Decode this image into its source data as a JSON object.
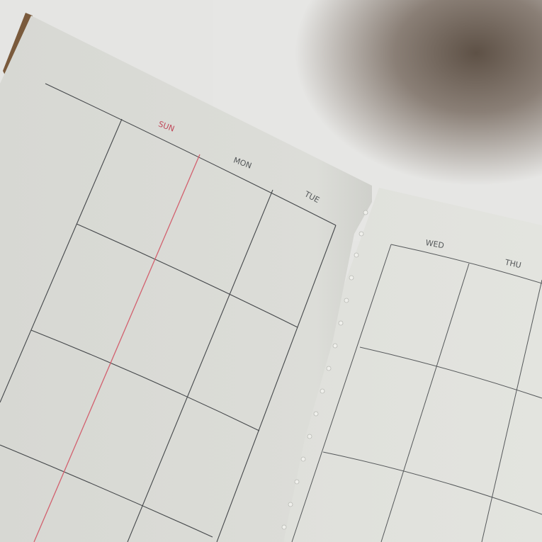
{
  "left_page": {
    "days": [
      {
        "label": "SUN",
        "color": "#c0485a"
      },
      {
        "label": "MON",
        "color": "#55585a"
      },
      {
        "label": "TUE",
        "color": "#55585a"
      }
    ]
  },
  "right_page": {
    "days": [
      {
        "label": "WED",
        "color": "#55585a"
      },
      {
        "label": "THU",
        "color": "#55585a"
      }
    ]
  },
  "colors": {
    "paper": "#dcddd8",
    "paper_right": "#e2e3de",
    "grid_line": "#44474a",
    "sunday_line": "#d2606e",
    "cover": "#7a5a3c"
  }
}
